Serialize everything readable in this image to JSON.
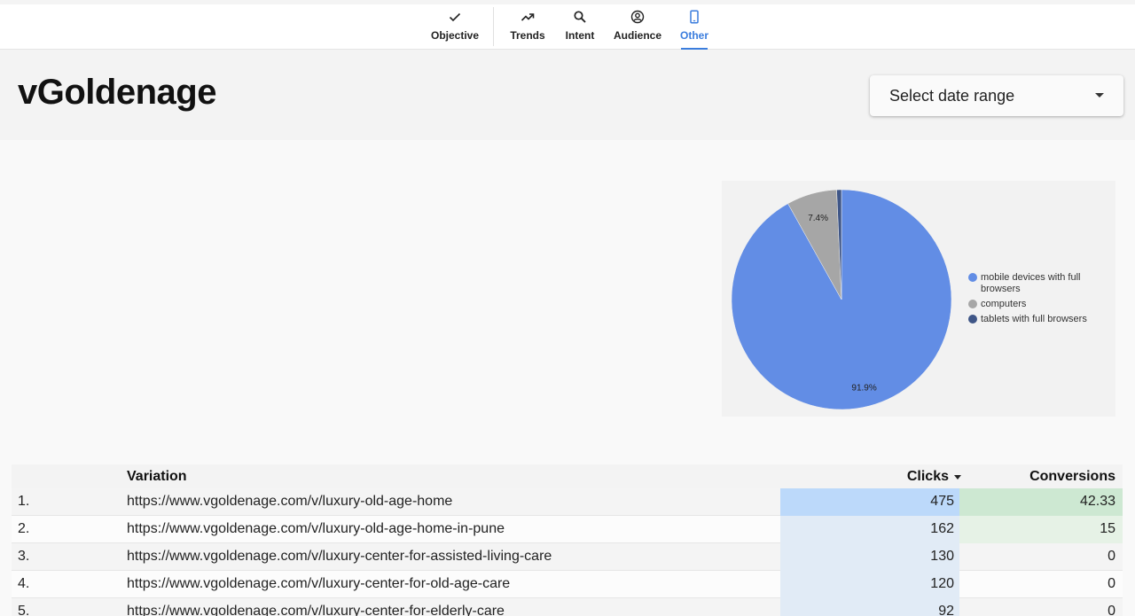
{
  "nav": {
    "items": [
      {
        "label": "Objective",
        "icon": "check-icon"
      },
      {
        "label": "Trends",
        "icon": "trending-up-icon"
      },
      {
        "label": "Intent",
        "icon": "search-icon"
      },
      {
        "label": "Audience",
        "icon": "person-circle-icon"
      },
      {
        "label": "Other",
        "icon": "smartphone-icon",
        "active": true
      }
    ],
    "accent_color": "#3b7ddd"
  },
  "header": {
    "title": "vGoldenage",
    "date_range": {
      "label": "Select date range"
    }
  },
  "chart_data": {
    "type": "pie",
    "labels": [
      "mobile devices with full browsers",
      "computers",
      "tablets with full browsers"
    ],
    "values": [
      91.9,
      7.4,
      0.7
    ],
    "slice_labels": [
      "91.9%",
      "7.4%",
      ""
    ],
    "colors": [
      "#628de5",
      "#a6a6a6",
      "#3f5687"
    ],
    "legend_position": "right"
  },
  "table": {
    "columns": {
      "variation": "Variation",
      "clicks": "Clicks",
      "conversions": "Conversions"
    },
    "rows": [
      {
        "index": "1.",
        "variation": "https://www.vgoldenage.com/v/luxury-old-age-home",
        "clicks": "475",
        "conversions": "42.33",
        "click_level": 1.0,
        "conv_level": 1.0
      },
      {
        "index": "2.",
        "variation": "https://www.vgoldenage.com/v/luxury-old-age-home-in-pune",
        "clicks": "162",
        "conversions": "15",
        "click_level": 0.34,
        "conv_level": 0.35
      },
      {
        "index": "3.",
        "variation": "https://www.vgoldenage.com/v/luxury-center-for-assisted-living-care",
        "clicks": "130",
        "conversions": "0",
        "click_level": 0.27,
        "conv_level": 0
      },
      {
        "index": "4.",
        "variation": "https://www.vgoldenage.com/v/luxury-center-for-old-age-care",
        "clicks": "120",
        "conversions": "0",
        "click_level": 0.25,
        "conv_level": 0
      },
      {
        "index": "5.",
        "variation": "https://www.vgoldenage.com/v/luxury-center-for-elderly-care",
        "clicks": "92",
        "conversions": "0",
        "click_level": 0.19,
        "conv_level": 0
      }
    ],
    "heat_colors": {
      "clicks_high": "#bcd9fa",
      "clicks_low": "#e1ebf6",
      "conv_high": "#cde8d2",
      "conv_low": "#e6f2e6"
    }
  }
}
